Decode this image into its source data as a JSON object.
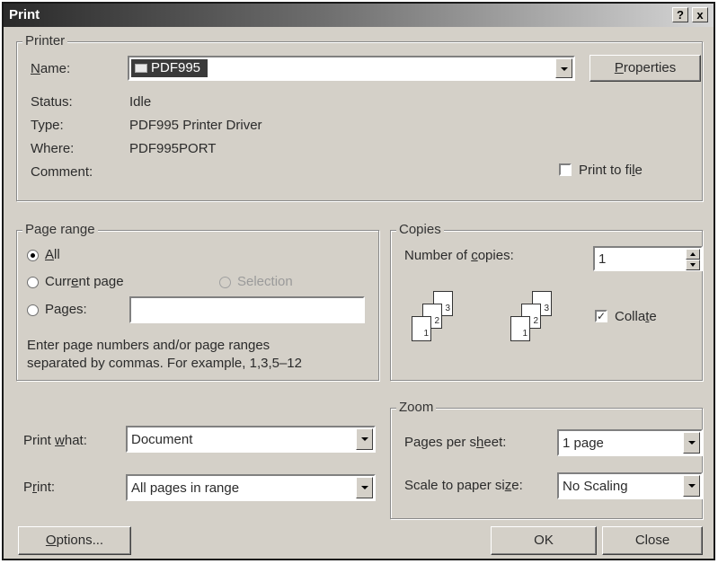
{
  "window": {
    "title": "Print",
    "help_btn": "?",
    "close_btn": "x"
  },
  "printer": {
    "legend": "Printer",
    "name_label": "Name:",
    "name_value": "PDF995",
    "properties_label": "Properties",
    "status_label": "Status:",
    "status_value": "Idle",
    "type_label": "Type:",
    "type_value": "PDF995 Printer Driver",
    "where_label": "Where:",
    "where_value": "PDF995PORT",
    "comment_label": "Comment:",
    "print_to_file_label": "Print to file",
    "print_to_file_checked": false
  },
  "page_range": {
    "legend": "Page range",
    "all_label": "All",
    "current_page_label": "Current page",
    "selection_label": "Selection",
    "pages_label": "Pages:",
    "pages_value": "",
    "selected": "All",
    "hint_line1": "Enter page numbers and/or page ranges",
    "hint_line2": "separated by commas.  For example, 1,3,5–12"
  },
  "copies": {
    "legend": "Copies",
    "number_label": "Number of copies:",
    "number_value": "1",
    "collate_label": "Collate",
    "collate_checked": true,
    "page_labels": [
      "3",
      "2",
      "1"
    ]
  },
  "print_what": {
    "label": "Print what:",
    "value": "Document"
  },
  "print": {
    "label": "Print:",
    "value": "All pages in range"
  },
  "zoom": {
    "legend": "Zoom",
    "pages_per_sheet_label": "Pages per sheet:",
    "pages_per_sheet_value": "1 page",
    "scale_label": "Scale to paper size:",
    "scale_value": "No Scaling"
  },
  "buttons": {
    "options": "Options...",
    "ok": "OK",
    "close": "Close"
  }
}
